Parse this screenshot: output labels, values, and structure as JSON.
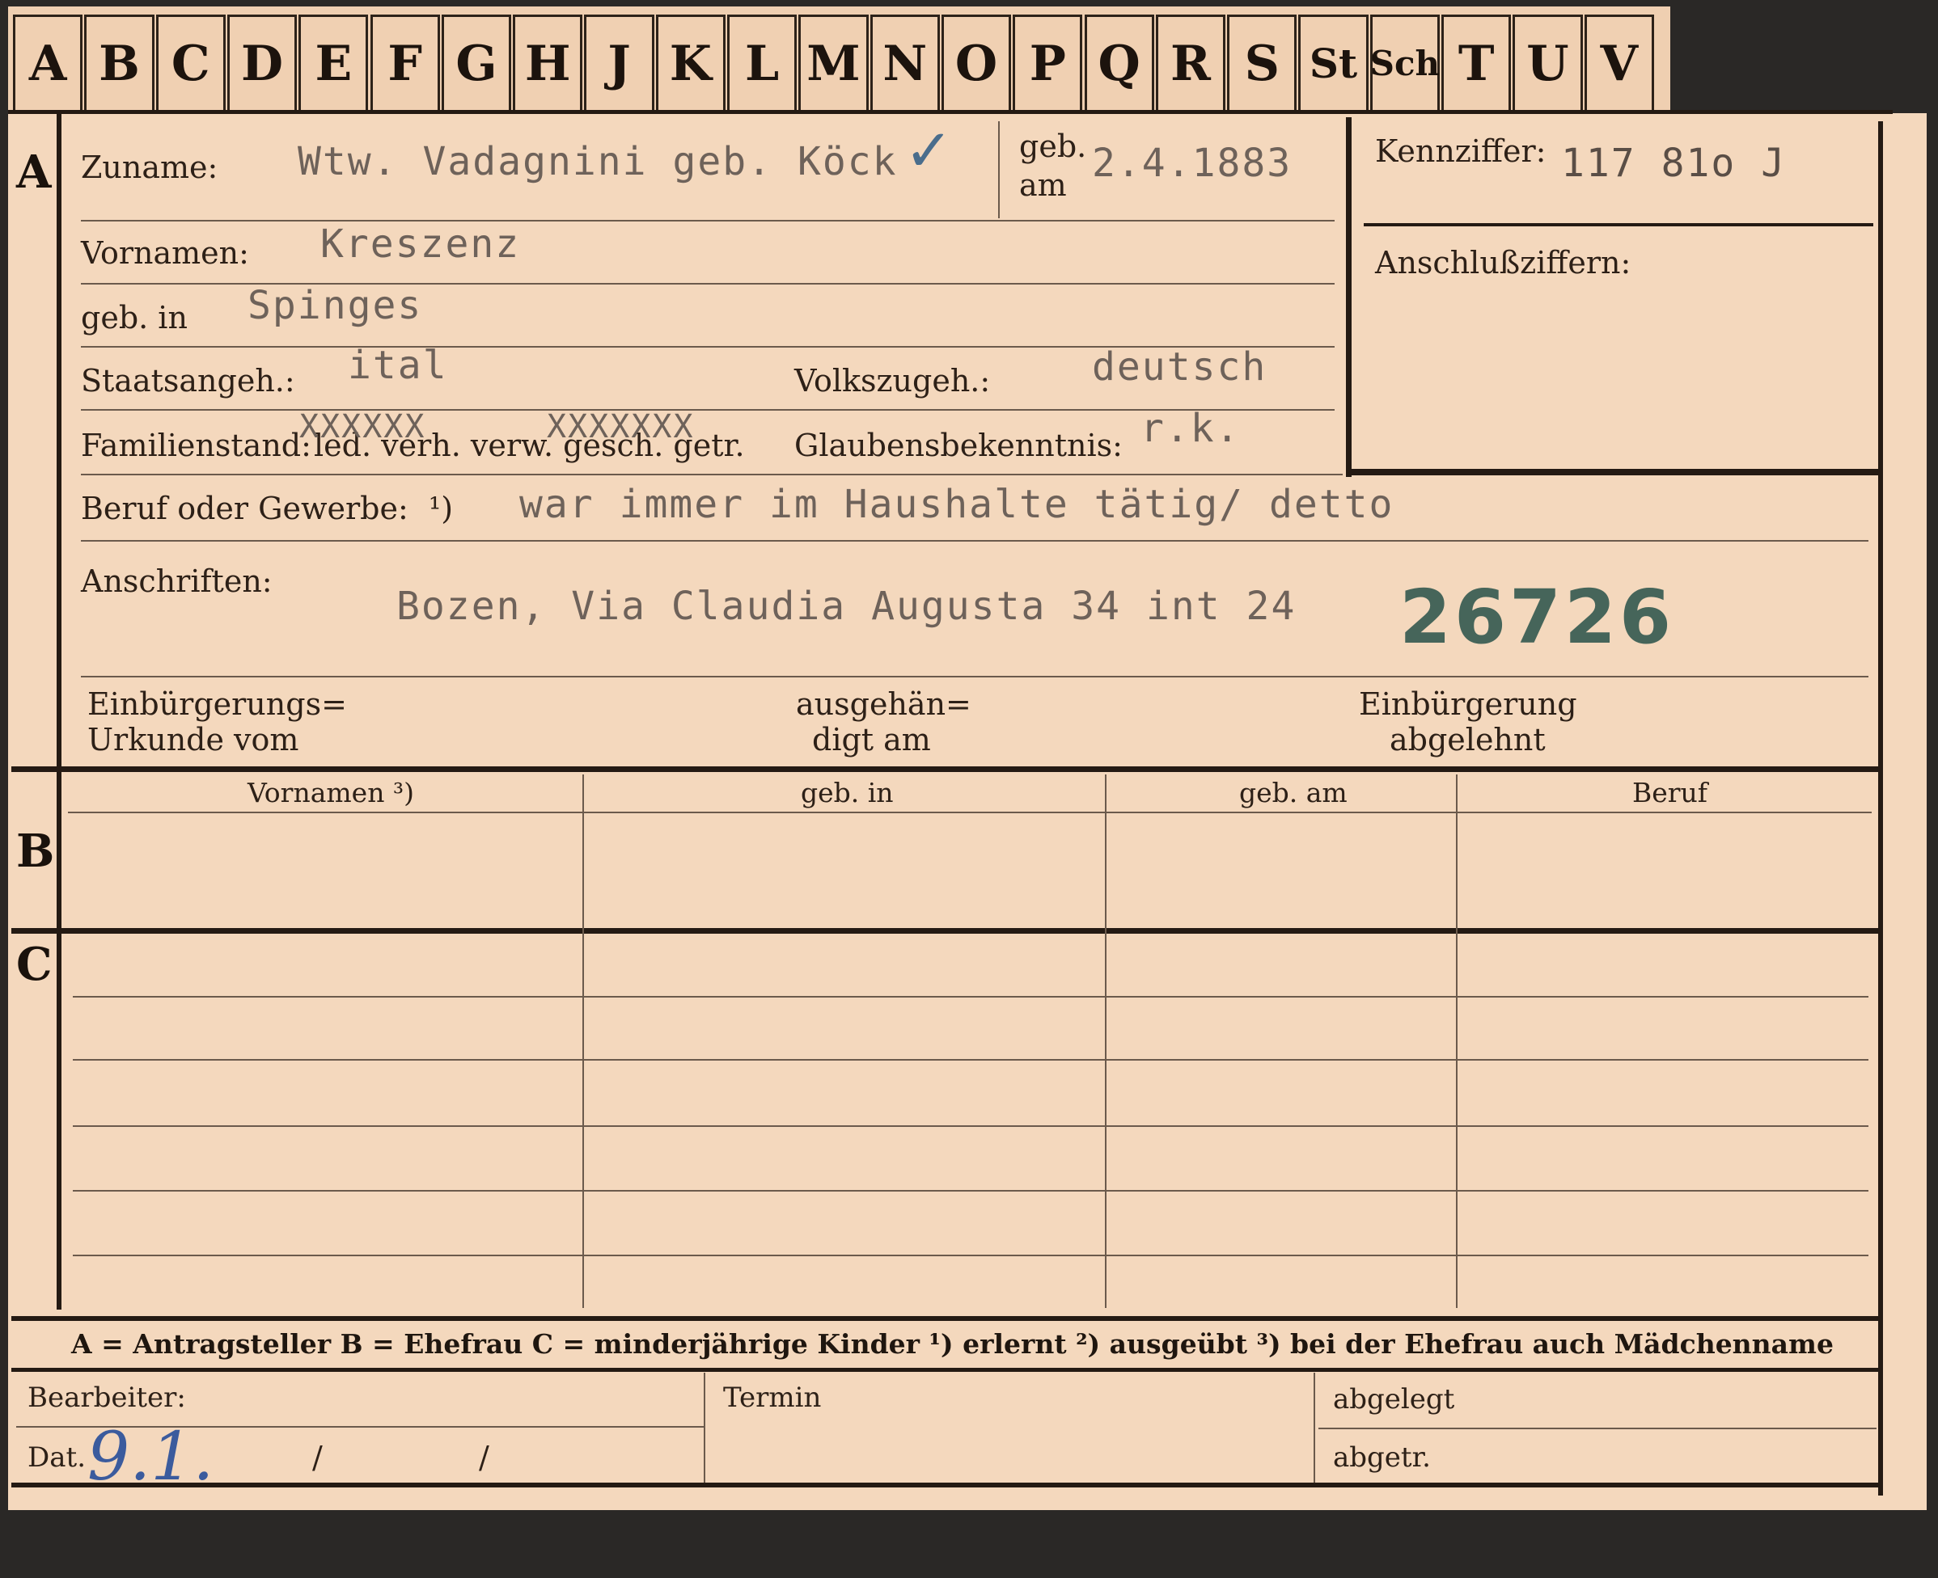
{
  "index_tabs": [
    "A",
    "B",
    "C",
    "D",
    "E",
    "F",
    "G",
    "H",
    "J",
    "K",
    "L",
    "M",
    "N",
    "O",
    "P",
    "Q",
    "R",
    "S",
    "St",
    "Sch",
    "T",
    "U",
    "V"
  ],
  "sections": {
    "a": "A",
    "b": "B",
    "c": "C"
  },
  "applicant": {
    "surname_label": "Zuname:",
    "surname_value": "Wtw. Vadagnini geb. Köck",
    "surname_check": "✓",
    "birth_date_label_1": "geb.",
    "birth_date_label_2": "am",
    "birth_date_value": "2.4.1883",
    "first_names_label": "Vornamen:",
    "first_names_value": "Kreszenz",
    "birthplace_label": "geb. in",
    "birthplace_value": "Spinges",
    "citizenship_label": "Staatsangeh.:",
    "citizenship_value": "ital",
    "ethnicity_label": "Volkszugeh.:",
    "ethnicity_value": "deutsch",
    "marital_status_label": "Familienstand:",
    "marital_status_options": "led. verh. verw. gesch. getr.",
    "marital_strike_1": "XXXXXX",
    "marital_strike_2": "XXXXXXX",
    "religion_label": "Glaubensbekenntnis:",
    "religion_value": "r.k.",
    "profession_label": "Beruf oder Gewerbe:",
    "profession_footnote": "¹)",
    "profession_value": "war immer im Haushalte tätig/ detto",
    "address_label": "Anschriften:",
    "address_value": "Bozen, Via Claudia Augusta 34 int 24",
    "stamp_number": "26726",
    "naturalization_doc_label_1": "Einbürgerungs=",
    "naturalization_doc_label_2": "Urkunde vom",
    "handed_out_label_1": "ausgehän=",
    "handed_out_label_2": "digt am",
    "naturalization_refused_label_1": "Einbürgerung",
    "naturalization_refused_label_2": "abgelehnt"
  },
  "identification": {
    "code_label": "Kennziffer:",
    "code_value": "117 81o J",
    "link_label": "Anschlußziffern:"
  },
  "spouse_table": {
    "headers": [
      "Vornamen ³)",
      "geb. in",
      "geb. am",
      "Beruf"
    ]
  },
  "legend": "A = Antragsteller   B = Ehefrau   C = minderjährige Kinder   ¹) erlernt   ²) ausgeübt   ³) bei der Ehefrau auch Mädchenname",
  "footer": {
    "processor_label": "Bearbeiter:",
    "date_label": "Dat.",
    "date_handwritten": "9.1.",
    "date_slash_1": "/",
    "date_slash_2": "/",
    "deadline_label": "Termin",
    "filed_label": "abgelegt",
    "separated_label": "abgetr."
  }
}
